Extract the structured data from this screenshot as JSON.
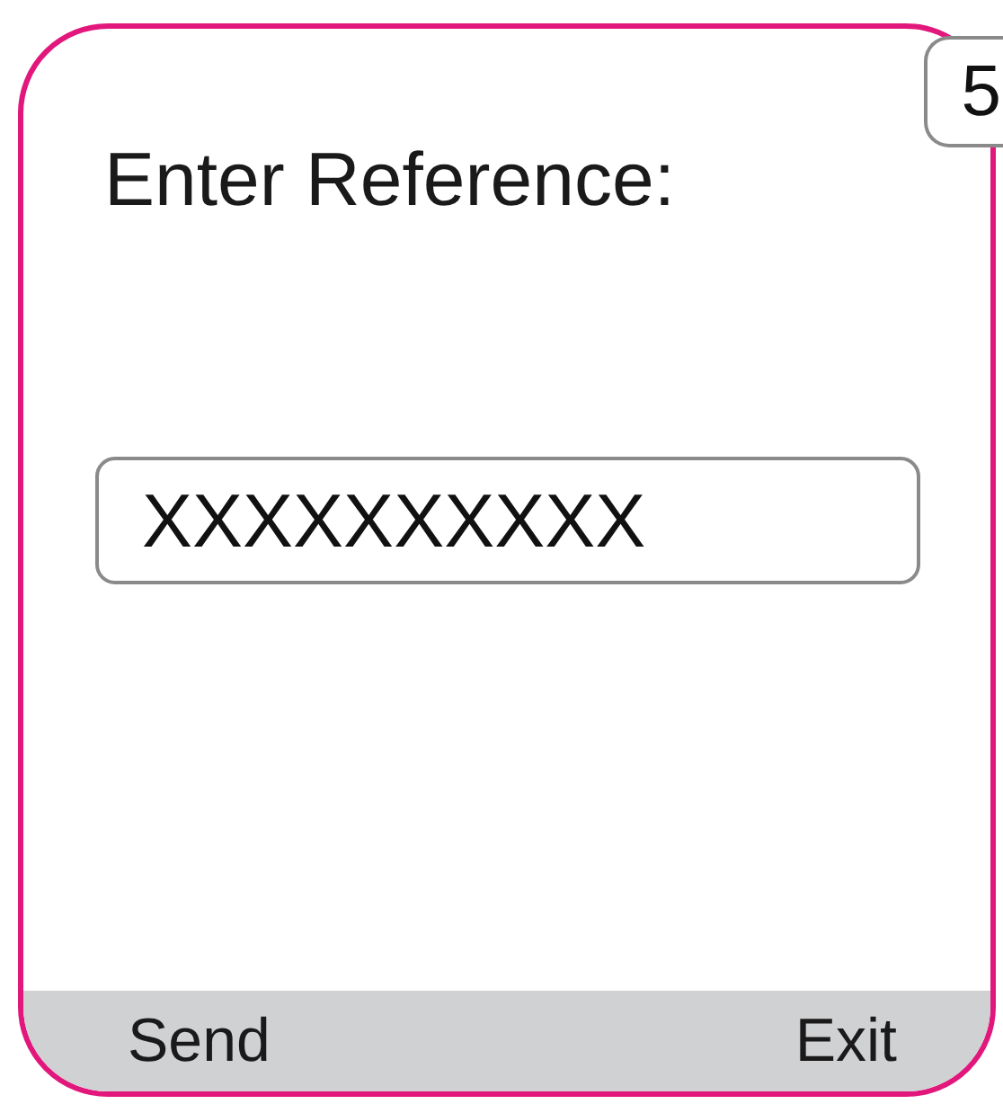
{
  "badge": "5",
  "prompt": "Enter Reference:",
  "reference_field": {
    "value": "XXXXXXXXXX"
  },
  "softkeys": [
    {
      "label": "Send"
    },
    {
      "label": "Exit"
    }
  ]
}
